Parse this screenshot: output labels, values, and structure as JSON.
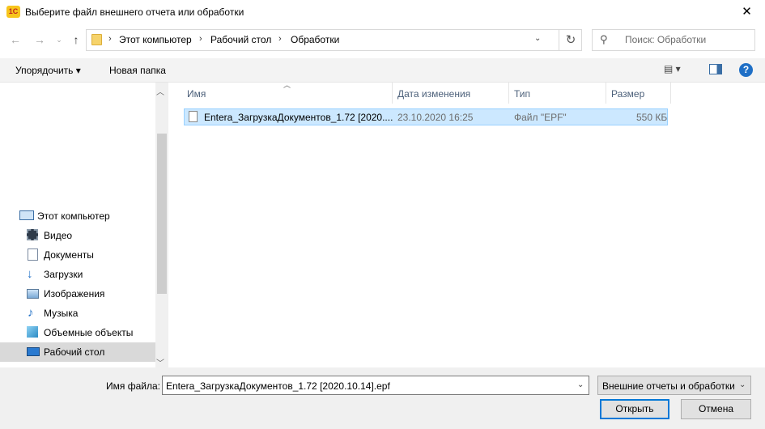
{
  "window": {
    "title": "Выберите файл внешнего отчета или обработки",
    "app_icon": "1С",
    "close_glyph": "✕"
  },
  "address": {
    "crumbs": [
      "Этот компьютер",
      "Рабочий стол",
      "Обработки"
    ],
    "sep": "›",
    "search_placeholder": "Поиск: Обработки"
  },
  "toolbar": {
    "organize_label": "Упорядочить ▾",
    "new_folder_label": "Новая папка"
  },
  "nav": {
    "items": [
      {
        "label": "Этот компьютер",
        "icon": "computer-icon"
      },
      {
        "label": "Видео",
        "icon": "video-icon"
      },
      {
        "label": "Документы",
        "icon": "documents-icon"
      },
      {
        "label": "Загрузки",
        "icon": "downloads-icon"
      },
      {
        "label": "Изображения",
        "icon": "pictures-icon"
      },
      {
        "label": "Музыка",
        "icon": "music-icon"
      },
      {
        "label": "Объемные объекты",
        "icon": "3d-objects-icon"
      },
      {
        "label": "Рабочий стол",
        "icon": "desktop-icon",
        "selected": true
      }
    ]
  },
  "list": {
    "columns": [
      "Имя",
      "Дата изменения",
      "Тип",
      "Размер"
    ],
    "rows": [
      {
        "name": "Entera_ЗагрузкаДокументов_1.72 [2020....",
        "date": "23.10.2020 16:25",
        "type": "Файл \"EPF\"",
        "size": "550 КБ"
      }
    ]
  },
  "footer": {
    "filename_label": "Имя файла:",
    "filename_value": "Entera_ЗагрузкаДокументов_1.72 [2020.10.14].epf",
    "filter_value": "Внешние отчеты и обработки",
    "open_label": "Открыть",
    "cancel_label": "Отмена"
  },
  "colors": {
    "selection": "#cce8ff",
    "accent": "#0078d7"
  }
}
